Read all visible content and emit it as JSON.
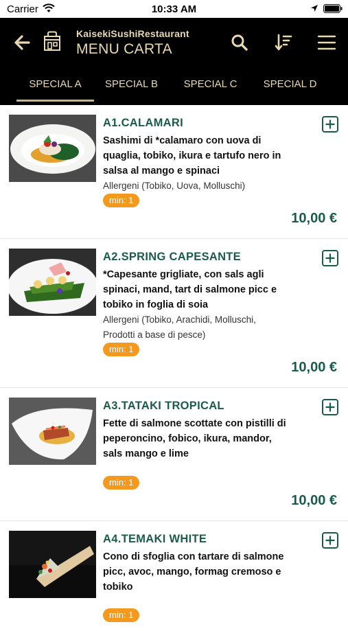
{
  "status_bar": {
    "carrier": "Carrier",
    "time": "10:33 AM"
  },
  "header": {
    "restaurant_name": "KaisekiSushiRestaurant",
    "title": "MENU CARTA",
    "icons": [
      "back-arrow-icon",
      "shop-bag-icon",
      "search-icon",
      "sort-icon",
      "menu-icon"
    ]
  },
  "tabs": [
    {
      "label": "SPECIAL A",
      "selected": true
    },
    {
      "label": "SPECIAL B",
      "selected": false
    },
    {
      "label": "SPECIAL C",
      "selected": false
    },
    {
      "label": "SPECIAL D",
      "selected": false
    }
  ],
  "items": [
    {
      "name": "A1.CALAMARI",
      "description": "Sashimi di *calamaro con uova di quaglia, tobiko, ikura e tartufo nero in salsa al mango e spinaci",
      "allergens": "Allergeni (Tobiko, Uova, Molluschi)",
      "min": "min: 1",
      "price": "10,00 €"
    },
    {
      "name": "A2.SPRING CAPESANTE",
      "description": "*Capesante grigliate, con sals agli spinaci, mand, tart di salmone picc e tobiko in foglia di soia",
      "allergens": "Allergeni (Tobiko, Arachidi, Molluschi, Prodotti a base di pesce)",
      "min": "min: 1",
      "price": "10,00 €"
    },
    {
      "name": "A3.TATAKI TROPICAL",
      "description": "Fette di salmone scottate con pistilli di peperoncino, fobico, ikura, mandor, sals mango e lime",
      "allergens": "",
      "min": "min: 1",
      "price": "10,00 €"
    },
    {
      "name": "A4.TEMAKI WHITE",
      "description": "Cono di sfoglia con tartare di salmone picc, avoc, mango, formag cremoso e tobiko",
      "allergens": "",
      "min": "min: 1",
      "price": ""
    }
  ],
  "colors": {
    "header_bg": "#000000",
    "header_text": "#e8d9b0",
    "accent_green": "#1a5c4a",
    "min_badge": "#f39a1e"
  }
}
